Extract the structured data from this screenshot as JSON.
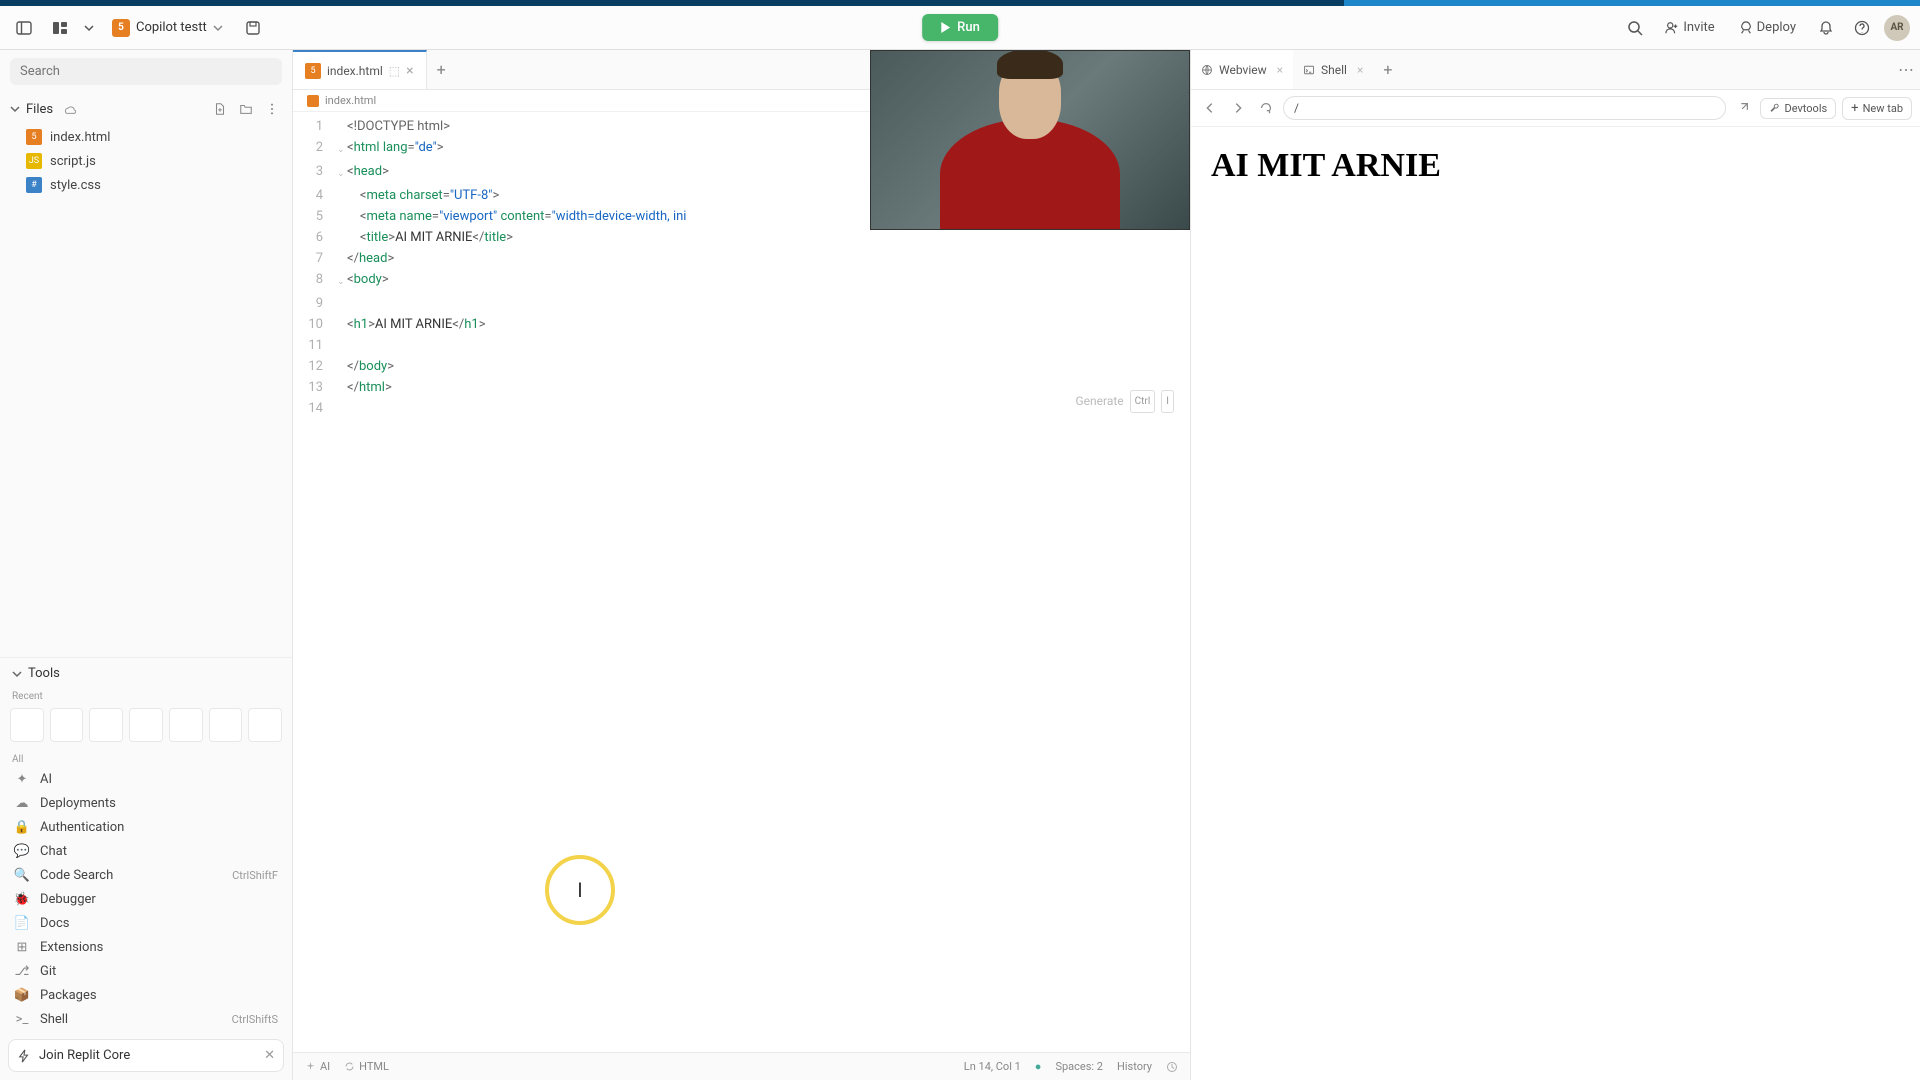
{
  "project": {
    "name": "Copilot testt"
  },
  "run_label": "Run",
  "topbar": {
    "invite": "Invite",
    "deploy": "Deploy",
    "avatar": "AR"
  },
  "sidebar": {
    "search_placeholder": "Search",
    "files_label": "Files",
    "files": [
      {
        "name": "index.html",
        "kind": "html"
      },
      {
        "name": "script.js",
        "kind": "js"
      },
      {
        "name": "style.css",
        "kind": "css"
      }
    ],
    "tools_label": "Tools",
    "recent_label": "Recent",
    "all_label": "All",
    "tools": [
      {
        "name": "AI",
        "shortcut": ""
      },
      {
        "name": "Deployments",
        "shortcut": ""
      },
      {
        "name": "Authentication",
        "shortcut": ""
      },
      {
        "name": "Chat",
        "shortcut": ""
      },
      {
        "name": "Code Search",
        "shortcut": "CtrlShiftF"
      },
      {
        "name": "Debugger",
        "shortcut": ""
      },
      {
        "name": "Docs",
        "shortcut": ""
      },
      {
        "name": "Extensions",
        "shortcut": ""
      },
      {
        "name": "Git",
        "shortcut": ""
      },
      {
        "name": "Packages",
        "shortcut": ""
      },
      {
        "name": "Shell",
        "shortcut": "CtrlShiftS"
      }
    ],
    "join_core": "Join Replit Core"
  },
  "editor": {
    "tab": "index.html",
    "breadcrumb": "index.html",
    "generate_label": "Generate",
    "generate_kbd1": "Ctrl",
    "generate_kbd2": "I",
    "cursor_mark": "I",
    "lines": [
      {
        "n": 1,
        "fold": "",
        "tokens": [
          [
            "<!",
            "punc"
          ],
          [
            "DOCTYPE html",
            "doc"
          ],
          [
            ">",
            "punc"
          ]
        ]
      },
      {
        "n": 2,
        "fold": "v",
        "tokens": [
          [
            "<",
            "punc"
          ],
          [
            "html",
            "tag"
          ],
          [
            " ",
            "txt"
          ],
          [
            "lang",
            "attr"
          ],
          [
            "=",
            "punc"
          ],
          [
            "\"de\"",
            "str"
          ],
          [
            ">",
            "punc"
          ]
        ]
      },
      {
        "n": 3,
        "fold": "v",
        "tokens": [
          [
            "<",
            "punc"
          ],
          [
            "head",
            "tag"
          ],
          [
            ">",
            "punc"
          ]
        ]
      },
      {
        "n": 4,
        "fold": "",
        "tokens": [
          [
            "    <",
            "punc"
          ],
          [
            "meta",
            "tag"
          ],
          [
            " ",
            "txt"
          ],
          [
            "charset",
            "attr"
          ],
          [
            "=",
            "punc"
          ],
          [
            "\"UTF-8\"",
            "str"
          ],
          [
            ">",
            "punc"
          ]
        ]
      },
      {
        "n": 5,
        "fold": "",
        "tokens": [
          [
            "    <",
            "punc"
          ],
          [
            "meta",
            "tag"
          ],
          [
            " ",
            "txt"
          ],
          [
            "name",
            "attr"
          ],
          [
            "=",
            "punc"
          ],
          [
            "\"viewport\"",
            "str"
          ],
          [
            " ",
            "txt"
          ],
          [
            "content",
            "attr"
          ],
          [
            "=",
            "punc"
          ],
          [
            "\"width=device-width, ini",
            "str"
          ]
        ]
      },
      {
        "n": 6,
        "fold": "",
        "tokens": [
          [
            "    <",
            "punc"
          ],
          [
            "title",
            "tag"
          ],
          [
            ">",
            "punc"
          ],
          [
            "AI MIT ARNIE",
            "txt"
          ],
          [
            "</",
            "punc"
          ],
          [
            "title",
            "tag"
          ],
          [
            ">",
            "punc"
          ]
        ]
      },
      {
        "n": 7,
        "fold": "",
        "tokens": [
          [
            "</",
            "punc"
          ],
          [
            "head",
            "tag"
          ],
          [
            ">",
            "punc"
          ]
        ]
      },
      {
        "n": 8,
        "fold": "v",
        "tokens": [
          [
            "<",
            "punc"
          ],
          [
            "body",
            "tag"
          ],
          [
            ">",
            "punc"
          ]
        ]
      },
      {
        "n": 9,
        "fold": "",
        "tokens": [
          [
            "",
            "txt"
          ]
        ]
      },
      {
        "n": 10,
        "fold": "",
        "tokens": [
          [
            "<",
            "punc"
          ],
          [
            "h1",
            "tag"
          ],
          [
            ">",
            "punc"
          ],
          [
            "AI MIT ARNIE",
            "txt"
          ],
          [
            "</",
            "punc"
          ],
          [
            "h1",
            "tag"
          ],
          [
            ">",
            "punc"
          ]
        ]
      },
      {
        "n": 11,
        "fold": "",
        "tokens": [
          [
            "",
            "txt"
          ]
        ]
      },
      {
        "n": 12,
        "fold": "",
        "tokens": [
          [
            "</",
            "punc"
          ],
          [
            "body",
            "tag"
          ],
          [
            ">",
            "punc"
          ]
        ]
      },
      {
        "n": 13,
        "fold": "",
        "tokens": [
          [
            "</",
            "punc"
          ],
          [
            "html",
            "tag"
          ],
          [
            ">",
            "punc"
          ]
        ]
      },
      {
        "n": 14,
        "fold": "",
        "tokens": [
          [
            "",
            "txt"
          ]
        ]
      }
    ]
  },
  "status": {
    "ai": "AI",
    "lang": "HTML",
    "pos": "Ln 14, Col 1",
    "spaces": "Spaces: 2",
    "history": "History"
  },
  "right": {
    "tabs": {
      "webview": "Webview",
      "shell": "Shell"
    },
    "url": "/",
    "devtools": "Devtools",
    "new_tab": "New tab",
    "heading": "AI MIT ARNIE"
  }
}
